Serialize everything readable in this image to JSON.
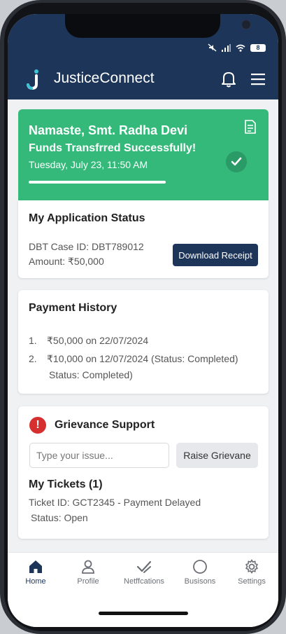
{
  "status_bar": {
    "battery": "8"
  },
  "app": {
    "name": "JusticeConnect"
  },
  "hero": {
    "greeting": "Namaste, Smt. Radha Devi",
    "message": "Funds Transfrred Successfully!",
    "datetime": "Tuesday, July 23, 11:50 AM"
  },
  "application_status": {
    "title": "My Application Status",
    "case_id": "DBT Case ID: DBT789012",
    "amount": "Amount: ₹50,000",
    "download_button": "Download Receipt"
  },
  "payment_history": {
    "title": "Payment History",
    "items": [
      {
        "num": "1.",
        "text": "₹50,000 on 22/07/2024"
      },
      {
        "num": "2.",
        "text": "₹10,000 on 12/07/2024 (Status: Completed)",
        "subtext": "Status: Completed)"
      }
    ]
  },
  "grievance": {
    "title": "Grievance Support",
    "input_placeholder": "Type your issue...",
    "raise_button": "Raise Grievane",
    "tickets_title": "My Tickets (1)",
    "ticket_line": "Ticket ID: GCT2345 - Payment Delayed",
    "ticket_status": "Status: Open"
  },
  "bottom_nav": [
    {
      "label": "Home",
      "icon": "home-icon",
      "active": true
    },
    {
      "label": "Profile",
      "icon": "person-icon"
    },
    {
      "label": "Netffcations",
      "icon": "notification-icon"
    },
    {
      "label": "Busisons",
      "icon": "circle-icon"
    },
    {
      "label": "Settings",
      "icon": "gear-icon"
    }
  ],
  "colors": {
    "primary": "#1d3559",
    "success": "#34b97a",
    "danger": "#d62f2f"
  }
}
